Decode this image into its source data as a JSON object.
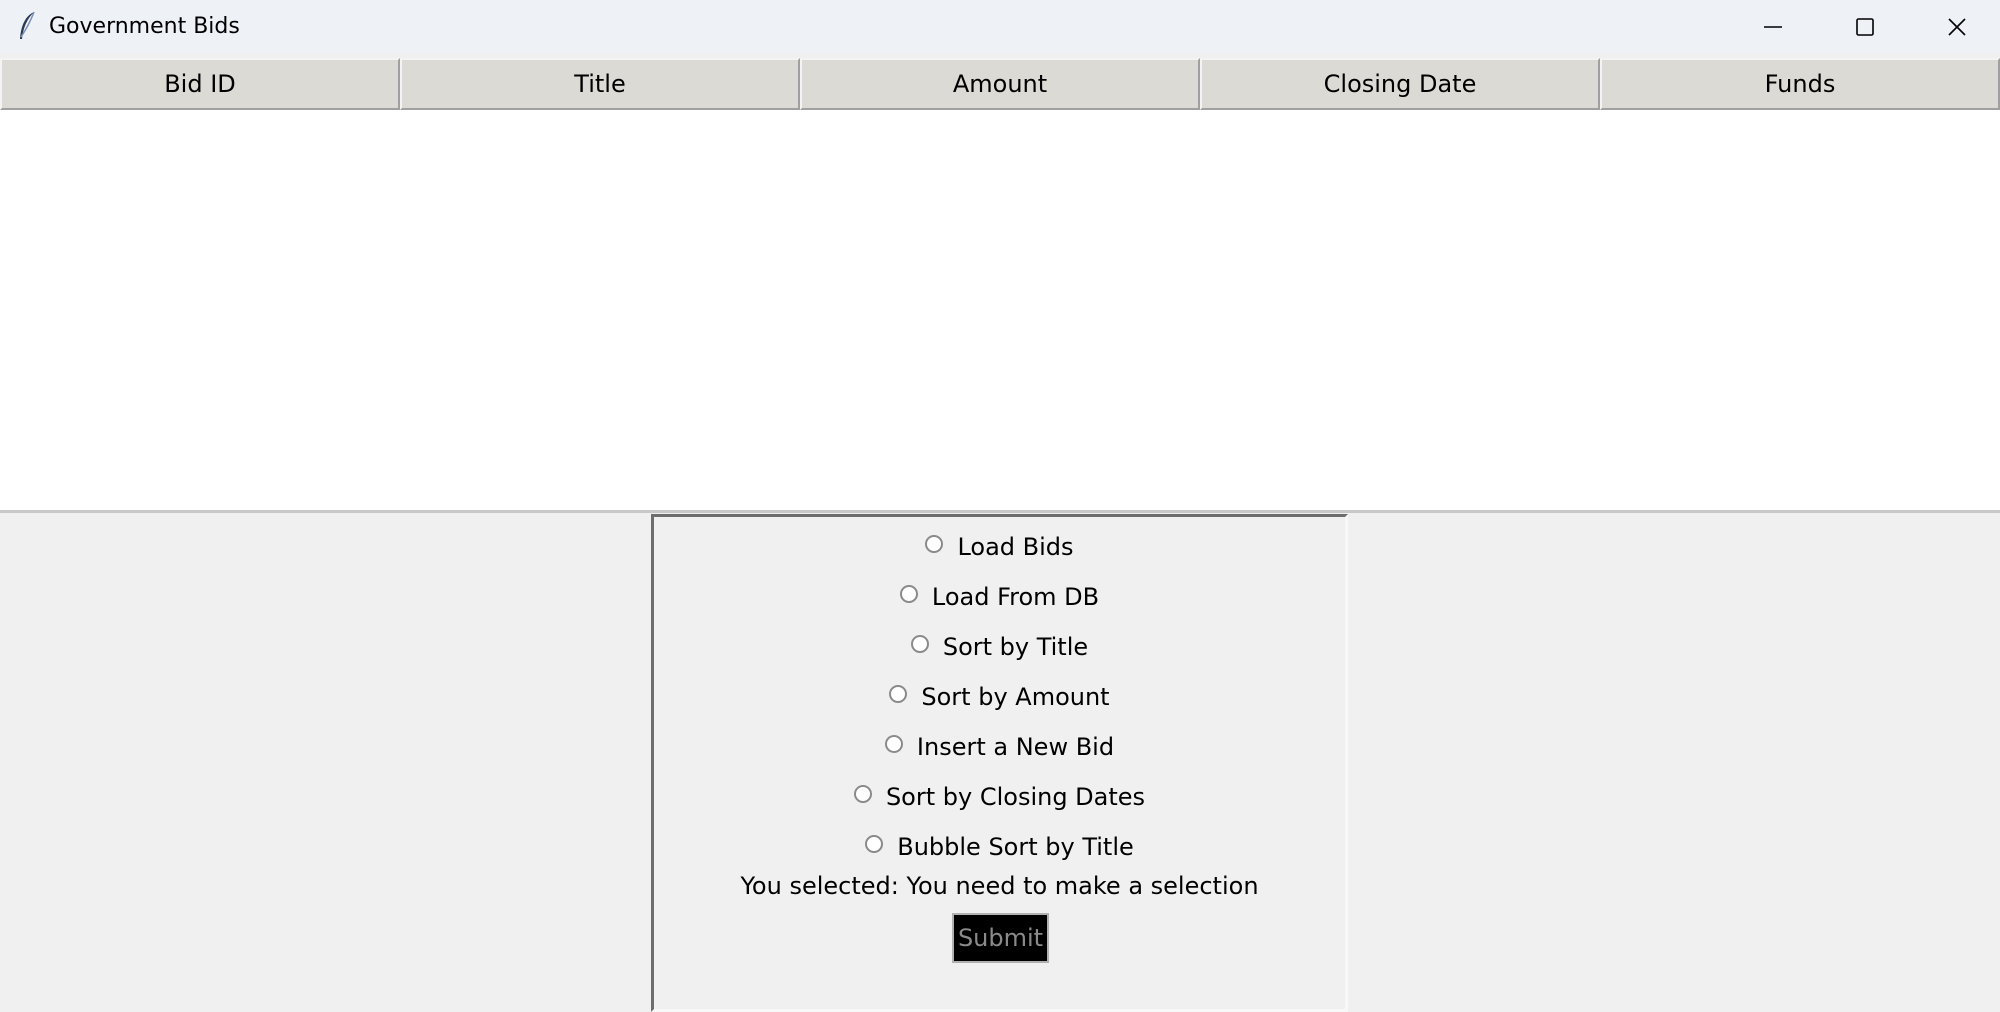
{
  "window": {
    "title": "Government Bids",
    "icon": "feather-icon",
    "controls": [
      "minimize-icon",
      "maximize-icon",
      "close-icon"
    ]
  },
  "table": {
    "columns": [
      "Bid ID",
      "Title",
      "Amount",
      "Closing Date",
      "Funds"
    ],
    "rows": []
  },
  "options": [
    {
      "label": "Load Bids",
      "selected": false
    },
    {
      "label": "Load From DB",
      "selected": false
    },
    {
      "label": "Sort by Title",
      "selected": false
    },
    {
      "label": "Sort by Amount",
      "selected": false
    },
    {
      "label": "Insert a New Bid",
      "selected": false
    },
    {
      "label": "Sort by Closing Dates",
      "selected": false
    },
    {
      "label": "Bubble Sort by Title",
      "selected": false
    }
  ],
  "status_text": "You selected: You need to make a selection",
  "submit_label": "Submit"
}
